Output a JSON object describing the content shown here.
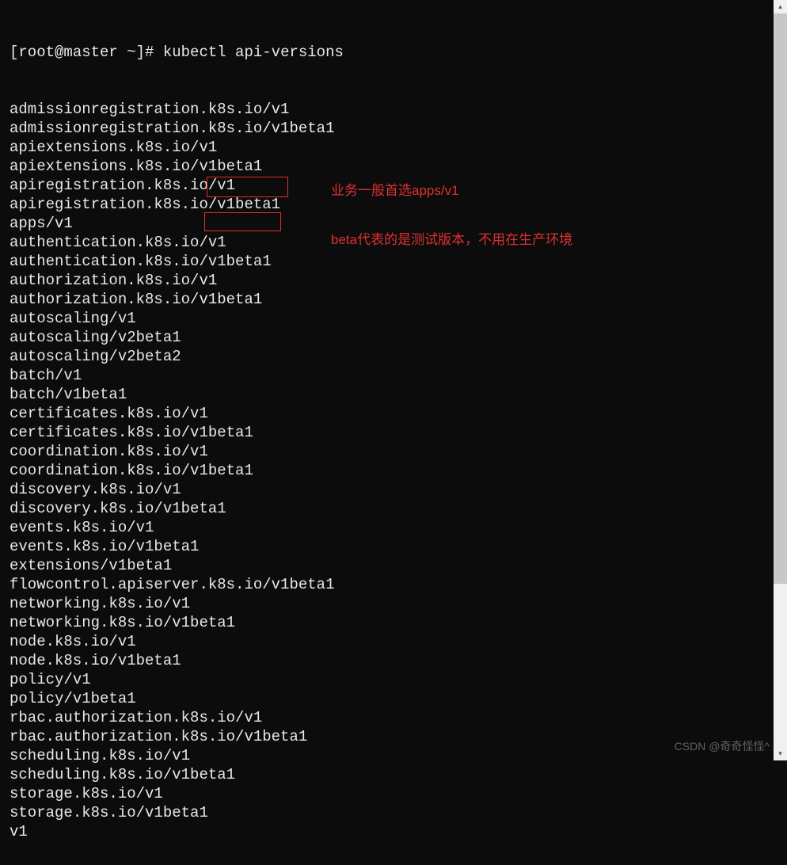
{
  "prompt": "[root@master ~]# ",
  "command": "kubectl api-versions",
  "output": [
    "admissionregistration.k8s.io/v1",
    "admissionregistration.k8s.io/v1beta1",
    "apiextensions.k8s.io/v1",
    "apiextensions.k8s.io/v1beta1",
    "apiregistration.k8s.io/v1",
    "apiregistration.k8s.io/v1beta1",
    "apps/v1",
    "authentication.k8s.io/v1",
    "authentication.k8s.io/v1beta1",
    "authorization.k8s.io/v1",
    "authorization.k8s.io/v1beta1",
    "autoscaling/v1",
    "autoscaling/v2beta1",
    "autoscaling/v2beta2",
    "batch/v1",
    "batch/v1beta1",
    "certificates.k8s.io/v1",
    "certificates.k8s.io/v1beta1",
    "coordination.k8s.io/v1",
    "coordination.k8s.io/v1beta1",
    "discovery.k8s.io/v1",
    "discovery.k8s.io/v1beta1",
    "events.k8s.io/v1",
    "events.k8s.io/v1beta1",
    "extensions/v1beta1",
    "flowcontrol.apiserver.k8s.io/v1beta1",
    "networking.k8s.io/v1",
    "networking.k8s.io/v1beta1",
    "node.k8s.io/v1",
    "node.k8s.io/v1beta1",
    "policy/v1",
    "policy/v1beta1",
    "rbac.authorization.k8s.io/v1",
    "rbac.authorization.k8s.io/v1beta1",
    "scheduling.k8s.io/v1",
    "scheduling.k8s.io/v1beta1",
    "storage.k8s.io/v1",
    "storage.k8s.io/v1beta1",
    "v1"
  ],
  "annotations": {
    "note1": "业务一般首选apps/v1",
    "note2": "beta代表的是测试版本，不用在生产环境"
  },
  "scrollbar": {
    "up_glyph": "▴",
    "down_glyph": "▾"
  },
  "watermark": "CSDN @奇奇怪怪^"
}
